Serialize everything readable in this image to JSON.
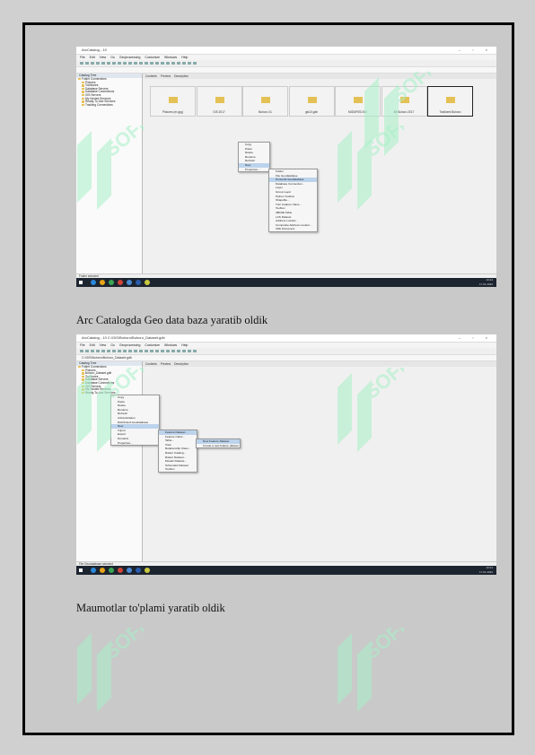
{
  "captions": {
    "first": "Arc Catalogda Geo data baza yaratib oldik",
    "second": "Maumotlar to'plami yaratib oldik"
  },
  "watermark": {
    "text": "SOFF",
    "color": "#a8f0c8"
  },
  "shot1": {
    "title": "ArcCatalog - 10",
    "menu": [
      "File",
      "Edit",
      "View",
      "Go",
      "Geoprocessing",
      "Customize",
      "Windows",
      "Help"
    ],
    "location": "",
    "tree_header": "Catalog Tree",
    "tree": [
      "Folder Connections",
      "Pictures",
      "Toolboxes",
      "Database Servers",
      "Database Connections",
      "GIS Servers",
      "My Hosted Services",
      "Ready-To-Use Services",
      "Tracking Connections"
    ],
    "tabs": [
      "Contents",
      "Preview",
      "Description"
    ],
    "thumbs": [
      "Pictures (ex.jpg)",
      "GIS 2017",
      "Buhoro 31",
      "gis10.gdb",
      "MODIFIED 8.0",
      "Bil Buhoro 2017",
      "Toshkent Buhoro"
    ],
    "context_menu": [
      "Copy",
      "Paste",
      "Delete",
      "Rename",
      "Refresh",
      "New",
      "Properties..."
    ],
    "submenu": [
      "Folder",
      "File Geodatabase",
      "Personal Geodatabase",
      "Database Connection...",
      "Layer",
      "Group Layer",
      "Python Toolbox",
      "Shapefile...",
      "Turn Feature Class...",
      "Toolbox",
      "dBASE Table",
      "LAS Dataset",
      "Address Locator...",
      "Composite Address Locator...",
      "XML Document"
    ],
    "status": "Folder selected",
    "tray_time": "10:24",
    "tray_date": "17.01.2022"
  },
  "shot2": {
    "title": "ArcCatalog - 10 C:\\GIS\\Buhoro\\Buhoro_Dataset.gdb",
    "menu": [
      "File",
      "Edit",
      "View",
      "Go",
      "Geoprocessing",
      "Customize",
      "Windows",
      "Help"
    ],
    "location": "C:\\GIS\\Buhoro\\Buhoro_Dataset.gdb",
    "tree_header": "Catalog Tree",
    "tree": [
      "Folder Connections",
      "Pictures",
      "Buhoro_Dataset.gdb",
      "Toolboxes",
      "Database Servers",
      "Database Connections",
      "GIS Servers",
      "My Hosted Services",
      "Ready-To-Use Services"
    ],
    "tabs": [
      "Contents",
      "Preview",
      "Description"
    ],
    "context_menu": [
      "Copy",
      "Paste",
      "Delete",
      "Rename",
      "Refresh",
      "Administration",
      "Distributed Geodatabase",
      "New",
      "Import",
      "Export",
      "Domains",
      "Properties..."
    ],
    "submenu": [
      "Feature Dataset...",
      "Feature Class...",
      "Table...",
      "View",
      "Relationship Class...",
      "Raster Catalog...",
      "Raster Dataset...",
      "Mosaic Dataset...",
      "Schematic Dataset",
      "Toolbox"
    ],
    "subsub": [
      "New Feature Dataset",
      "Create a new feature dataset"
    ],
    "status": "File Geodatabase selected",
    "tray_time": "10:31",
    "tray_date": "17.01.2022"
  }
}
